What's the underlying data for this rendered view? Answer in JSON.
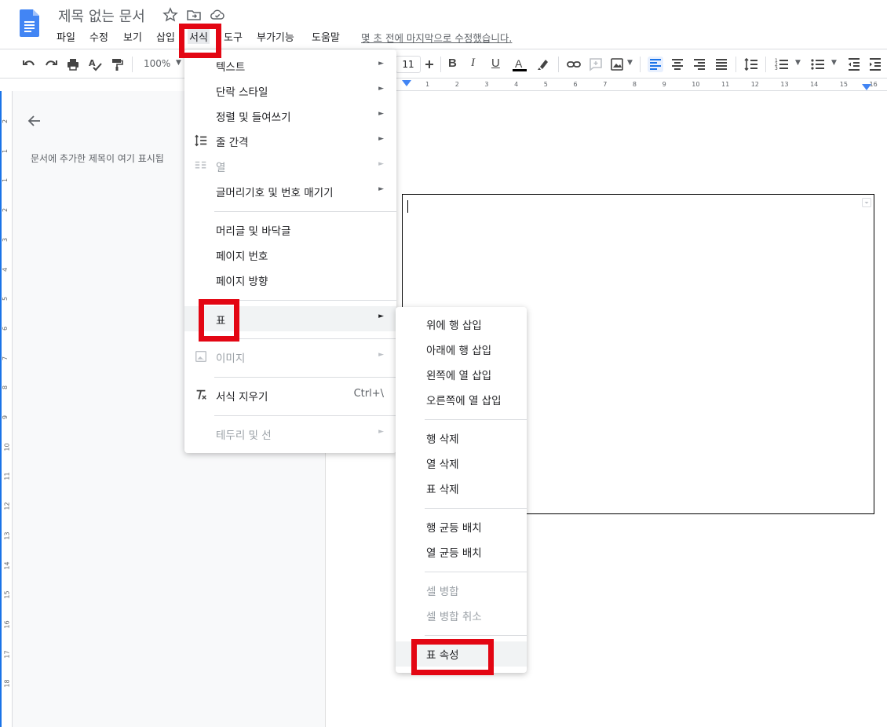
{
  "header": {
    "title": "제목 없는 문서",
    "menu": [
      "파일",
      "수정",
      "보기",
      "삽입",
      "서식",
      "도구",
      "부가기능",
      "도움말"
    ],
    "last_edit": "몇 초 전에 마지막으로 수정했습니다."
  },
  "toolbar": {
    "zoom": "100%",
    "font_size": "11"
  },
  "outline": {
    "placeholder": "문서에 추가한 제목이 여기 표시됩"
  },
  "ruler": {
    "h_labels": [
      "1",
      "2",
      "3",
      "4",
      "5",
      "6",
      "7",
      "8",
      "9",
      "10",
      "11",
      "12",
      "13",
      "14",
      "15",
      "16"
    ],
    "v_labels": [
      "2",
      "1",
      "1",
      "2",
      "3",
      "4",
      "5",
      "6",
      "7",
      "8",
      "9",
      "10",
      "11",
      "12",
      "13",
      "14",
      "15",
      "16",
      "17",
      "18"
    ]
  },
  "format_menu": {
    "items": [
      {
        "label": "텍스트",
        "submenu": true,
        "disabled": false
      },
      {
        "label": "단락 스타일",
        "submenu": true,
        "disabled": false
      },
      {
        "label": "정렬 및 들여쓰기",
        "submenu": true,
        "disabled": false
      },
      {
        "label": "줄 간격",
        "submenu": true,
        "disabled": false
      },
      {
        "label": "열",
        "submenu": true,
        "disabled": true
      },
      {
        "label": "글머리기호 및 번호 매기기",
        "submenu": true,
        "disabled": false
      },
      {
        "label": "머리글 및 바닥글",
        "submenu": false,
        "disabled": false
      },
      {
        "label": "페이지 번호",
        "submenu": false,
        "disabled": false
      },
      {
        "label": "페이지 방향",
        "submenu": false,
        "disabled": false
      },
      {
        "label": "표",
        "submenu": true,
        "disabled": false
      },
      {
        "label": "이미지",
        "submenu": true,
        "disabled": true
      },
      {
        "label": "서식 지우기",
        "shortcut": "Ctrl+\\",
        "disabled": false
      },
      {
        "label": "테두리 및 선",
        "submenu": true,
        "disabled": true
      }
    ]
  },
  "table_menu": {
    "items": [
      {
        "label": "위에 행 삽입",
        "disabled": false
      },
      {
        "label": "아래에 행 삽입",
        "disabled": false
      },
      {
        "label": "왼쪽에 열 삽입",
        "disabled": false
      },
      {
        "label": "오른쪽에 열 삽입",
        "disabled": false
      },
      {
        "label": "행 삭제",
        "disabled": false
      },
      {
        "label": "열 삭제",
        "disabled": false
      },
      {
        "label": "표 삭제",
        "disabled": false
      },
      {
        "label": "행 균등 배치",
        "disabled": false
      },
      {
        "label": "열 균등 배치",
        "disabled": false
      },
      {
        "label": "셀 병합",
        "disabled": true
      },
      {
        "label": "셀 병합 취소",
        "disabled": true
      },
      {
        "label": "표 속성",
        "disabled": false
      }
    ]
  },
  "colors": {
    "highlight": "#e30613",
    "docs_blue": "#4285f4",
    "accent_blue": "#1a73e8"
  },
  "icons": [
    "docs-logo-icon",
    "star-icon",
    "move-folder-icon",
    "cloud-status-icon",
    "undo-icon",
    "redo-icon",
    "print-icon",
    "spellcheck-icon",
    "paint-format-icon",
    "link-icon",
    "comment-icon",
    "image-icon",
    "align-left-icon",
    "align-center-icon",
    "align-right-icon",
    "justify-icon",
    "line-spacing-icon",
    "numbered-list-icon",
    "bulleted-list-icon",
    "decrease-indent-icon",
    "increase-indent-icon",
    "back-arrow-icon",
    "columns-icon",
    "clear-formatting-icon"
  ]
}
